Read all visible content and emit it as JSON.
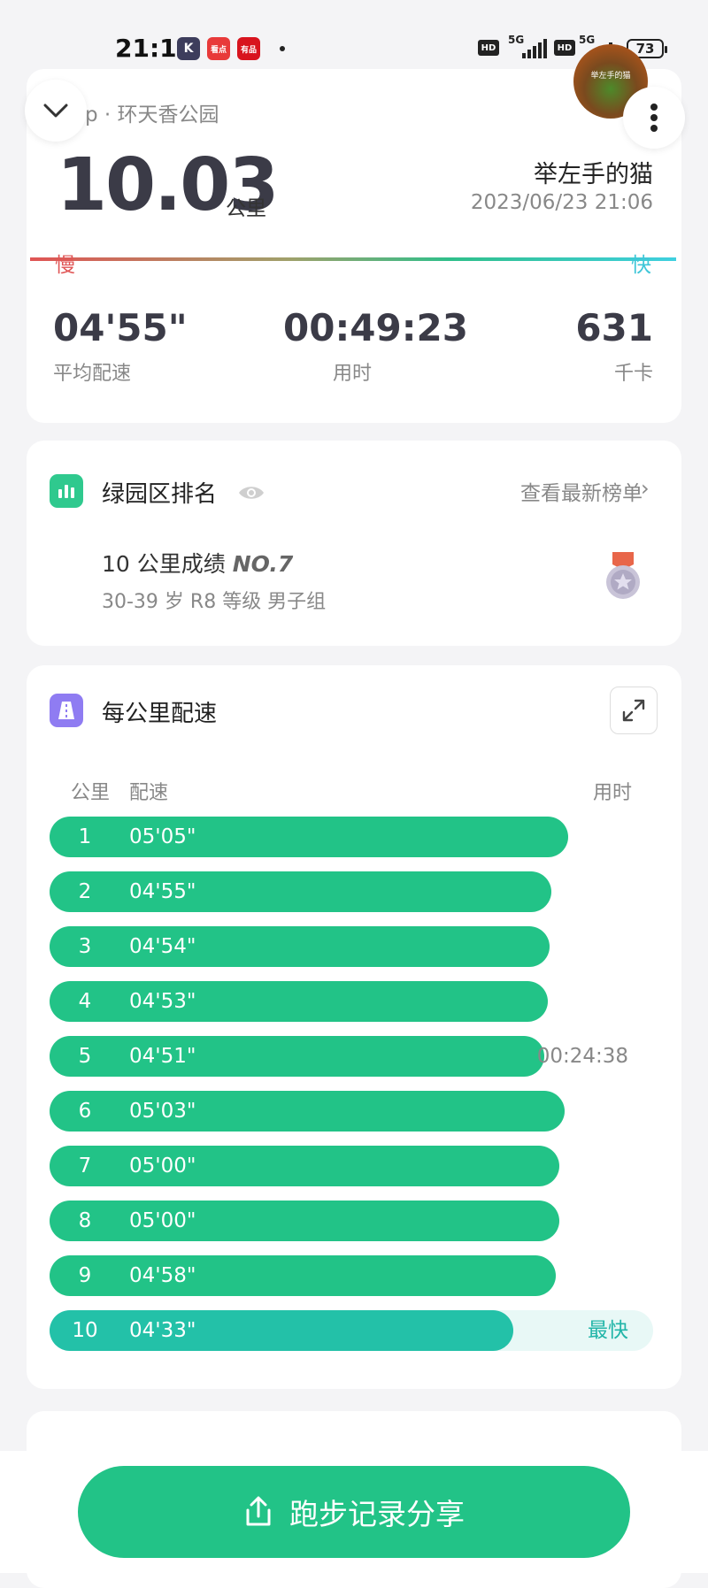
{
  "status_bar": {
    "time": "21:10",
    "apps": [
      {
        "name": "keep-app-icon",
        "glyph": "K",
        "color": "#3d3d5c"
      },
      {
        "name": "kandian-app-icon",
        "glyph": "看点",
        "color": "#e83a3a"
      },
      {
        "name": "fuli-app-icon",
        "glyph": "有品",
        "color": "#d8141e"
      }
    ],
    "sim1": {
      "hd": "HD",
      "network": "5G"
    },
    "sim2": {
      "hd": "HD",
      "network": "5G"
    },
    "battery": "73"
  },
  "summary": {
    "location": "p · 环天香公园",
    "distance": "10.03",
    "distance_unit": "公里",
    "user_name": "举左手的猫",
    "avatar_text": "举左手的猫",
    "date_time": "2023/06/23 21:06",
    "slow_label": "慢",
    "fast_label": "快",
    "stats": {
      "avg_pace": {
        "value": "04'55\"",
        "label": "平均配速"
      },
      "duration": {
        "value": "00:49:23",
        "label": "用时"
      },
      "calories": {
        "value": "631",
        "label": "千卡"
      }
    }
  },
  "ranking": {
    "title": "绿园区排名",
    "link": "查看最新榜单",
    "result_label": "10 公里成绩",
    "rank": "NO.7",
    "group": "30-39 岁 R8 等级 男子组"
  },
  "splits": {
    "title": "每公里配速",
    "headers": {
      "km": "公里",
      "pace": "配速",
      "time": "用时"
    },
    "bar_scale_seconds": 355,
    "rows": [
      {
        "km": "1",
        "pace": "05'05\"",
        "pace_seconds": 305,
        "time": "",
        "badge": ""
      },
      {
        "km": "2",
        "pace": "04'55\"",
        "pace_seconds": 295,
        "time": "",
        "badge": ""
      },
      {
        "km": "3",
        "pace": "04'54\"",
        "pace_seconds": 294,
        "time": "",
        "badge": ""
      },
      {
        "km": "4",
        "pace": "04'53\"",
        "pace_seconds": 293,
        "time": "",
        "badge": ""
      },
      {
        "km": "5",
        "pace": "04'51\"",
        "pace_seconds": 291,
        "time": "00:24:38",
        "badge": ""
      },
      {
        "km": "6",
        "pace": "05'03\"",
        "pace_seconds": 303,
        "time": "",
        "badge": ""
      },
      {
        "km": "7",
        "pace": "05'00\"",
        "pace_seconds": 300,
        "time": "",
        "badge": ""
      },
      {
        "km": "8",
        "pace": "05'00\"",
        "pace_seconds": 300,
        "time": "",
        "badge": ""
      },
      {
        "km": "9",
        "pace": "04'58\"",
        "pace_seconds": 298,
        "time": "",
        "badge": ""
      },
      {
        "km": "10",
        "pace": "04'33\"",
        "pace_seconds": 273,
        "time": "",
        "badge": "最快"
      }
    ]
  },
  "share_button": {
    "label": "跑步记录分享"
  },
  "colors": {
    "accent": "#22c387",
    "fastest": "#23c1a8",
    "slow": "#e05454",
    "fast": "#3fc6d8"
  }
}
